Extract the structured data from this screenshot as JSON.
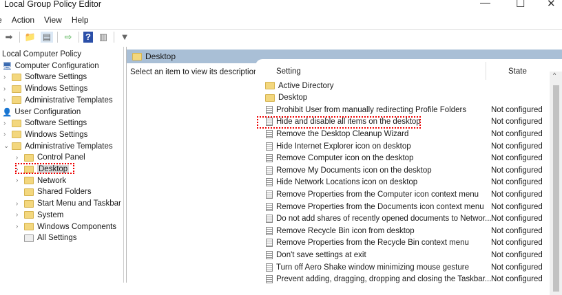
{
  "window": {
    "title": "Local Group Policy Editor",
    "minimize": "—",
    "maximize": "☐",
    "close": "✕"
  },
  "menu": [
    "e",
    "Action",
    "View",
    "Help"
  ],
  "toolbar": [
    "forward-icon",
    "up-folder-icon",
    "show-hide-tree-icon",
    "export-list-icon",
    "help-icon",
    "show-action-pane-icon",
    "filter-icon"
  ],
  "tree": [
    {
      "label": "Local Computer Policy",
      "level": 0,
      "chev": "",
      "icon": "none"
    },
    {
      "label": "Computer Configuration",
      "level": 0,
      "chev": "",
      "icon": "computer"
    },
    {
      "label": "Software Settings",
      "level": 1,
      "chev": ">",
      "icon": "folder"
    },
    {
      "label": "Windows Settings",
      "level": 1,
      "chev": ">",
      "icon": "folder"
    },
    {
      "label": "Administrative Templates",
      "level": 1,
      "chev": ">",
      "icon": "folder"
    },
    {
      "label": "User Configuration",
      "level": 0,
      "chev": "",
      "icon": "user"
    },
    {
      "label": "Software Settings",
      "level": 1,
      "chev": ">",
      "icon": "folder"
    },
    {
      "label": "Windows Settings",
      "level": 1,
      "chev": ">",
      "icon": "folder"
    },
    {
      "label": "Administrative Templates",
      "level": 1,
      "chev": "v",
      "icon": "folder"
    },
    {
      "label": "Control Panel",
      "level": 2,
      "chev": ">",
      "icon": "folder"
    },
    {
      "label": "Desktop",
      "level": 2,
      "chev": ">",
      "icon": "folder",
      "selected": true
    },
    {
      "label": "Network",
      "level": 2,
      "chev": ">",
      "icon": "folder"
    },
    {
      "label": "Shared Folders",
      "level": 2,
      "chev": "",
      "icon": "folder"
    },
    {
      "label": "Start Menu and Taskbar",
      "level": 2,
      "chev": ">",
      "icon": "folder"
    },
    {
      "label": "System",
      "level": 2,
      "chev": ">",
      "icon": "folder"
    },
    {
      "label": "Windows Components",
      "level": 2,
      "chev": ">",
      "icon": "folder"
    },
    {
      "label": "All Settings",
      "level": 2,
      "chev": "",
      "icon": "settings"
    }
  ],
  "right": {
    "header": "Desktop",
    "description": "Select an item to view its description.",
    "col_setting": "Setting",
    "col_state": "State",
    "rows": [
      {
        "name": "Active Directory",
        "type": "folder",
        "state": ""
      },
      {
        "name": "Desktop",
        "type": "folder",
        "state": ""
      },
      {
        "name": "Prohibit User from manually redirecting Profile Folders",
        "type": "policy",
        "state": "Not configured"
      },
      {
        "name": "Hide and disable all items on the desktop",
        "type": "policy",
        "state": "Not configured",
        "highlighted": true
      },
      {
        "name": "Remove the Desktop Cleanup Wizard",
        "type": "policy",
        "state": "Not configured"
      },
      {
        "name": "Hide Internet Explorer icon on desktop",
        "type": "policy",
        "state": "Not configured"
      },
      {
        "name": "Remove Computer icon on the desktop",
        "type": "policy",
        "state": "Not configured"
      },
      {
        "name": "Remove My Documents icon on the desktop",
        "type": "policy",
        "state": "Not configured"
      },
      {
        "name": "Hide Network Locations icon on desktop",
        "type": "policy",
        "state": "Not configured"
      },
      {
        "name": "Remove Properties from the Computer icon context menu",
        "type": "policy",
        "state": "Not configured"
      },
      {
        "name": "Remove Properties from the Documents icon context menu",
        "type": "policy",
        "state": "Not configured"
      },
      {
        "name": "Do not add shares of recently opened documents to Networ...",
        "type": "policy",
        "state": "Not configured"
      },
      {
        "name": "Remove Recycle Bin icon from desktop",
        "type": "policy",
        "state": "Not configured"
      },
      {
        "name": "Remove Properties from the Recycle Bin context menu",
        "type": "policy",
        "state": "Not configured"
      },
      {
        "name": "Don't save settings at exit",
        "type": "policy",
        "state": "Not configured"
      },
      {
        "name": "Turn off Aero Shake window minimizing mouse gesture",
        "type": "policy",
        "state": "Not configured"
      },
      {
        "name": "Prevent adding, dragging, dropping and closing the Taskbar...",
        "type": "policy",
        "state": "Not configured"
      }
    ]
  },
  "colors": {
    "header_bar": "#a9bfd6",
    "highlight": "#e00000",
    "folder": "#f3d77e"
  }
}
